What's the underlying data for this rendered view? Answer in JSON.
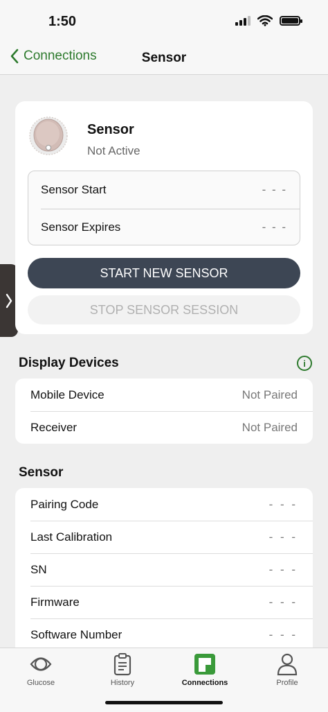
{
  "status_bar": {
    "time": "1:50"
  },
  "nav": {
    "back_label": "Connections",
    "title": "Sensor"
  },
  "sensor_card": {
    "name": "Sensor",
    "status": "Not Active",
    "rows": [
      {
        "label": "Sensor Start",
        "value": "- - -"
      },
      {
        "label": "Sensor Expires",
        "value": "- - -"
      }
    ],
    "start_button": "START NEW SENSOR",
    "stop_button": "STOP SENSOR SESSION"
  },
  "display_devices": {
    "title": "Display Devices",
    "rows": [
      {
        "label": "Mobile Device",
        "value": "Not Paired"
      },
      {
        "label": "Receiver",
        "value": "Not Paired"
      }
    ]
  },
  "sensor_section": {
    "title": "Sensor",
    "rows": [
      {
        "label": "Pairing Code",
        "value": "- - -"
      },
      {
        "label": "Last Calibration",
        "value": "- - -"
      },
      {
        "label": "SN",
        "value": "- - -"
      },
      {
        "label": "Firmware",
        "value": "- - -"
      },
      {
        "label": "Software Number",
        "value": "- - -"
      }
    ]
  },
  "tabs": [
    {
      "label": "Glucose",
      "icon": "eye-icon"
    },
    {
      "label": "History",
      "icon": "clipboard-icon"
    },
    {
      "label": "Connections",
      "icon": "connections-icon",
      "active": true
    },
    {
      "label": "Profile",
      "icon": "person-icon"
    }
  ],
  "colors": {
    "accent": "#2d7a2d",
    "primary_button": "#3d4654",
    "background": "#efefef"
  }
}
